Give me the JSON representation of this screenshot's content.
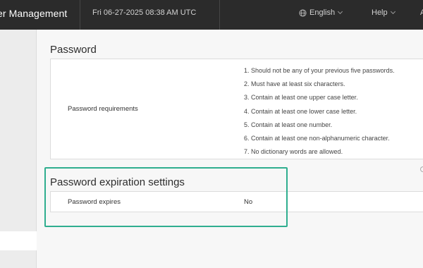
{
  "header": {
    "title": "er Management",
    "datetime": "Fri 06-27-2025 08:38 AM UTC",
    "language": "English",
    "help": "Help",
    "user_initial": "A"
  },
  "password_section": {
    "title": "Password",
    "requirements_label": "Password requirements",
    "requirements": [
      "1. Should not be any of your previous five passwords.",
      "2. Must have at least six characters.",
      "3. Contain at least one upper case letter.",
      "4. Contain at least one lower case letter.",
      "5. Contain at least one number.",
      "6. Contain at least one non-alphanumeric character.",
      "7. No dictionary words are allowed."
    ]
  },
  "expiration_section": {
    "title": "Password expiration settings",
    "expires_label": "Password expires",
    "expires_value": "No"
  },
  "colors": {
    "topbar": "#2b2b2b",
    "highlight": "#2fae8f"
  },
  "icons": {
    "language": "globe-icon",
    "dropdown": "chevron-down-icon"
  }
}
